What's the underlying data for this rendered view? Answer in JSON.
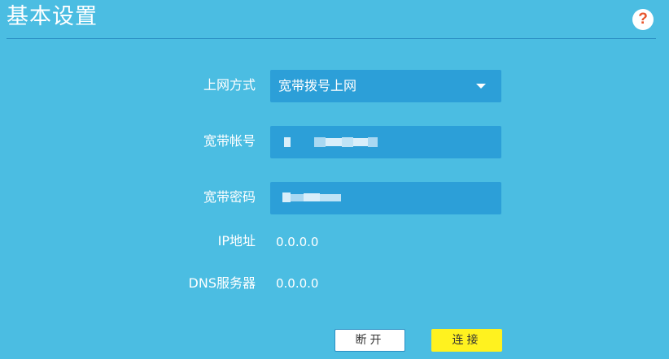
{
  "header": {
    "title": "基本设置",
    "help_icon": "question-mark-icon",
    "help_symbol": "?"
  },
  "form": {
    "connection_type": {
      "label": "上网方式",
      "value": "宽带拨号上网",
      "caret_icon": "chevron-down-icon"
    },
    "account": {
      "label": "宽带帐号"
    },
    "password": {
      "label": "宽带密码"
    },
    "ip": {
      "label": "IP地址",
      "value": "0.0.0.0"
    },
    "dns": {
      "label": "DNS服务器",
      "value": "0.0.0.0"
    }
  },
  "actions": {
    "disconnect_label": "断开",
    "connect_label": "连接"
  },
  "colors": {
    "background": "#4bbde2",
    "field": "#2c9fd8",
    "connect_button": "#fff21f",
    "help_icon": "#e8562c"
  }
}
